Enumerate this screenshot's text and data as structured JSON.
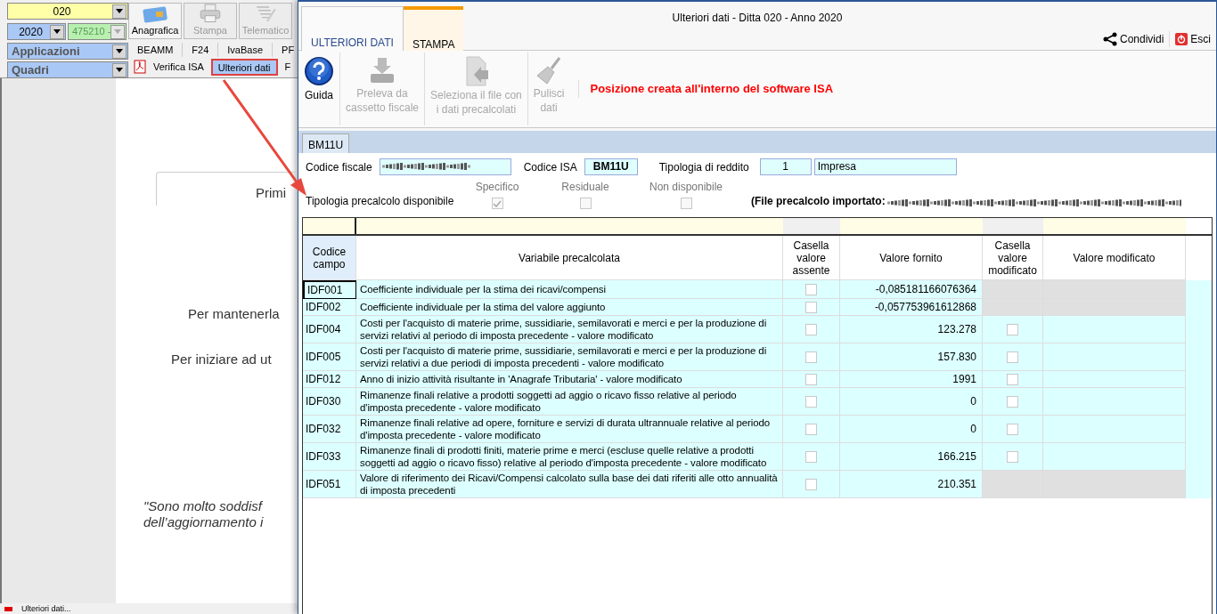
{
  "background_app": {
    "company_combo": {
      "value": "020"
    },
    "year_combo": {
      "value": "2020"
    },
    "code_combo": {
      "value": "475210 -",
      "disabled": true
    },
    "applications_combo": {
      "value": "Applicazioni"
    },
    "sections_combo": {
      "value": "Quadri"
    },
    "toolbar_buttons": [
      {
        "kind": "card",
        "label": "Anagrafica",
        "disabled": false
      },
      {
        "kind": "printer",
        "label": "Stampa",
        "disabled": true
      },
      {
        "kind": "send",
        "label": "Telematico",
        "disabled": true
      }
    ],
    "modules": [
      "BEAMM",
      "F24",
      "IvaBase",
      "PF"
    ],
    "section_tabs": [
      {
        "label": "Verifica ISA",
        "selected": false
      },
      {
        "label": "Ulteriori dati",
        "selected": true
      },
      {
        "label": "F",
        "selected": false
      }
    ],
    "page": {
      "tab": "Primi",
      "line_1": "Per mantenerla",
      "line_2": "Per iniziare ad ut",
      "quote_1": "\"Sono molto soddisf",
      "quote_2": "dell’aggiornamento i"
    },
    "status_bar": "Ulteriori dati..."
  },
  "dialog": {
    "title": "Ulteriori dati - Ditta 020 - Anno 2020",
    "tabs": [
      {
        "label": "ULTERIORI DATI",
        "selected": true
      },
      {
        "label": "STAMPA",
        "selected": false
      }
    ],
    "actions": [
      {
        "kind": "share",
        "label": "Condividi"
      },
      {
        "kind": "exit",
        "label": "Esci"
      }
    ],
    "ribbon": [
      {
        "kind": "help",
        "label": "Guida",
        "disabled": false
      },
      {
        "kind": "download",
        "label": "Preleva da\ncassetto fiscale",
        "disabled": true
      },
      {
        "kind": "file",
        "label": "Seleziona il file con\ni dati precalcolati",
        "disabled": true
      },
      {
        "kind": "broom",
        "label": "Pulisci\ndati",
        "disabled": true
      }
    ],
    "notice": "Posizione creata all'interno del software ISA",
    "model_tab": "BM11U",
    "fields": {
      "codice_fiscale_label": "Codice fiscale",
      "codice_isa_label": "Codice ISA",
      "codice_isa": "BM11U",
      "reddito_label": "Tipologia di reddito",
      "reddito_code": "1",
      "reddito_name": "Impresa"
    },
    "precalc": {
      "label": "Tipologia precalcolo disponibile",
      "options": [
        {
          "label": "Specifico",
          "checked": true
        },
        {
          "label": "Residuale",
          "checked": false
        },
        {
          "label": "Non disponibile",
          "checked": false
        }
      ],
      "file_label": "(File precalcolo importato:"
    },
    "table": {
      "columns": [
        "Codice\ncampo",
        "Variabile precalcolata",
        "Casella\nvalore\nassente",
        "Valore fornito",
        "Casella\nvalore\nmodificato",
        "Valore modificato"
      ],
      "rows": [
        {
          "code": "IDF001",
          "selected": true,
          "description": "Coefficiente individuale per la stima dei ricavi/compensi",
          "absent": false,
          "value": "-0,085181166076364",
          "editable": false
        },
        {
          "code": "IDF002",
          "selected": false,
          "description": "Coefficiente individuale per la stima del valore aggiunto",
          "absent": false,
          "value": "-0,057753961612868",
          "editable": false
        },
        {
          "code": "IDF004",
          "selected": false,
          "description": "Costi per l'acquisto di materie prime, sussidiarie, semilavorati e merci e per la produzione di servizi relativi al periodo di imposta precedente - valore modificato",
          "absent": false,
          "value": "123.278",
          "editable": true,
          "modified": false
        },
        {
          "code": "IDF005",
          "selected": false,
          "description": "Costi per l'acquisto di materie prime, sussidiarie, semilavorati e merci e per la produzione di servizi relativi a due periodi di imposta precedenti - valore modificato",
          "absent": false,
          "value": "157.830",
          "editable": true,
          "modified": false
        },
        {
          "code": "IDF012",
          "selected": false,
          "description": "Anno di inizio attività risultante in 'Anagrafe Tributaria' - valore modificato",
          "absent": false,
          "value": "1991",
          "editable": true,
          "modified": false
        },
        {
          "code": "IDF030",
          "selected": false,
          "description": "Rimanenze finali relative a prodotti soggetti ad aggio o ricavo fisso relative al periodo d'imposta precedente - valore modificato",
          "absent": false,
          "value": "0",
          "editable": true,
          "modified": false
        },
        {
          "code": "IDF032",
          "selected": false,
          "description": "Rimanenze finali relative ad opere, forniture e servizi di durata ultrannuale relative al periodo d'imposta precedente - valore modificato",
          "absent": false,
          "value": "0",
          "editable": true,
          "modified": false
        },
        {
          "code": "IDF033",
          "selected": false,
          "description": "Rimanenze finali di prodotti finiti, materie prime e merci (escluse quelle relative a prodotti soggetti ad aggio o ricavo fisso) relative al periodo d'imposta precedente - valore modificato",
          "absent": false,
          "value": "166.215",
          "editable": true,
          "modified": false
        },
        {
          "code": "IDF051",
          "selected": false,
          "description": "Valore di riferimento dei Ricavi/Compensi calcolato sulla base dei dati riferiti alle otto annualità di imposta precedenti",
          "absent": false,
          "value": "210.351",
          "editable": false
        }
      ]
    }
  }
}
